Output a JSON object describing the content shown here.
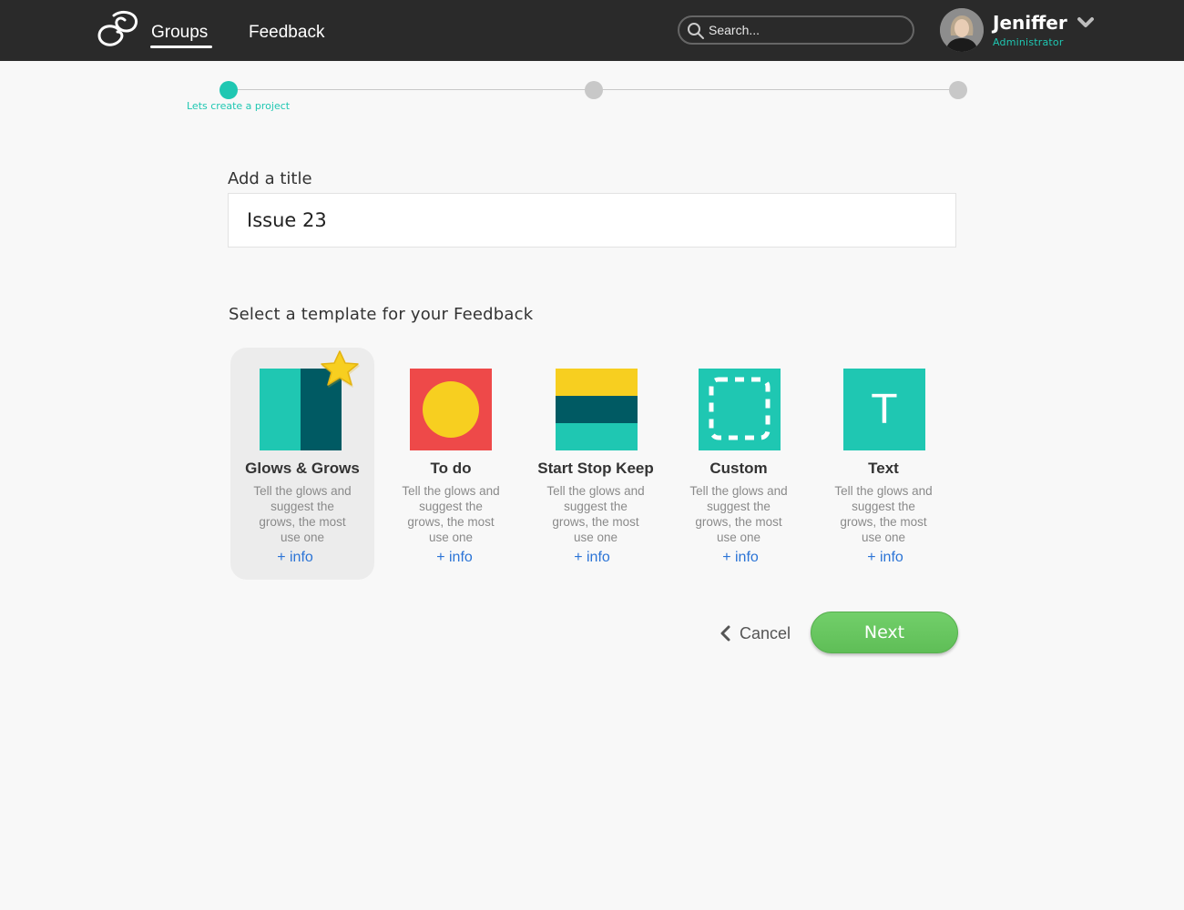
{
  "header": {
    "nav": [
      {
        "label": "Groups",
        "active": true
      },
      {
        "label": "Feedback",
        "active": false
      }
    ],
    "search": {
      "placeholder": "Search..."
    },
    "user": {
      "name": "Jeniffer",
      "role": "Administrator"
    }
  },
  "stepper": {
    "current_step": 1,
    "total_steps": 3,
    "step1_label": "Lets create a project"
  },
  "form": {
    "title_label": "Add a title",
    "title_value": "Issue 23",
    "template_label": "Select a template for your Feedback"
  },
  "templates": [
    {
      "name": "Glows & Grows",
      "desc": "Tell the glows and suggest the grows, the most use one",
      "info": "+ info",
      "selected": true,
      "favorite": true
    },
    {
      "name": "To do",
      "desc": "Tell the glows and suggest the grows, the most use one",
      "info": "+ info",
      "selected": false
    },
    {
      "name": "Start Stop Keep",
      "desc": "Tell the glows and suggest the grows, the most use one",
      "info": "+ info",
      "selected": false
    },
    {
      "name": "Custom",
      "desc": "Tell the glows and suggest the grows, the most use one",
      "info": "+ info",
      "selected": false
    },
    {
      "name": "Text",
      "desc": "Tell the glows and suggest the grows, the most use one",
      "info": "+ info",
      "selected": false,
      "glyph": "T"
    }
  ],
  "actions": {
    "cancel": "Cancel",
    "next": "Next"
  },
  "colors": {
    "accent": "#1fc7b2",
    "dark_teal": "#005a63",
    "red": "#ee4949",
    "yellow": "#f7cf20",
    "green": "#66c55e",
    "link_blue": "#2b74d6"
  }
}
